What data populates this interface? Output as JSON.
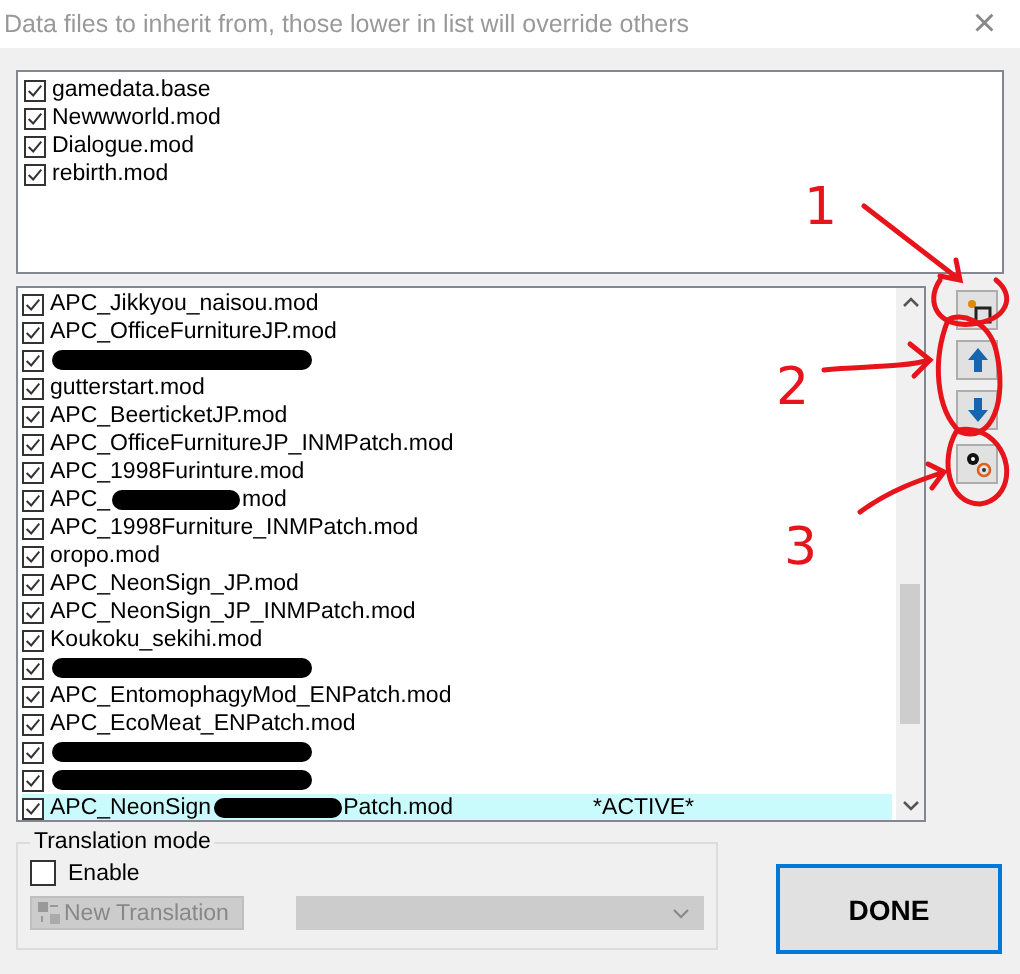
{
  "window": {
    "title": "Data files to inherit from, those lower in list will override others",
    "close": "×"
  },
  "base_files": [
    {
      "label": "gamedata.base",
      "checked": true
    },
    {
      "label": "Newwworld.mod",
      "checked": true
    },
    {
      "label": "Dialogue.mod",
      "checked": true
    },
    {
      "label": "rebirth.mod",
      "checked": true
    }
  ],
  "mod_files": [
    {
      "kind": "plain",
      "before": "APC_Jikkyou_naisou.mod",
      "checked": true,
      "selected": false
    },
    {
      "kind": "plain",
      "before": "APC_OfficeFurnitureJP.mod",
      "checked": true,
      "selected": false
    },
    {
      "kind": "redacted",
      "checked": true,
      "selected": false
    },
    {
      "kind": "plain",
      "before": "gutterstart.mod",
      "checked": true,
      "selected": false
    },
    {
      "kind": "plain",
      "before": "APC_BeerticketJP.mod",
      "checked": true,
      "selected": false
    },
    {
      "kind": "plain",
      "before": "APC_OfficeFurnitureJP_INMPatch.mod",
      "checked": true,
      "selected": false
    },
    {
      "kind": "plain",
      "before": "APC_1998Furinture.mod",
      "checked": true,
      "selected": false
    },
    {
      "kind": "partial",
      "before": "APC_",
      "after": "mod",
      "checked": true,
      "selected": false
    },
    {
      "kind": "plain",
      "before": "APC_1998Furniture_INMPatch.mod",
      "checked": true,
      "selected": false
    },
    {
      "kind": "plain",
      "before": "oropo.mod",
      "checked": true,
      "selected": false
    },
    {
      "kind": "plain",
      "before": "APC_NeonSign_JP.mod",
      "checked": true,
      "selected": false
    },
    {
      "kind": "plain",
      "before": "APC_NeonSign_JP_INMPatch.mod",
      "checked": true,
      "selected": false
    },
    {
      "kind": "plain",
      "before": "Koukoku_sekihi.mod",
      "checked": true,
      "selected": false
    },
    {
      "kind": "redacted",
      "checked": true,
      "selected": false
    },
    {
      "kind": "plain",
      "before": "APC_EntomophagyMod_ENPatch.mod",
      "checked": true,
      "selected": false
    },
    {
      "kind": "plain",
      "before": "APC_EcoMeat_ENPatch.mod",
      "checked": true,
      "selected": false
    },
    {
      "kind": "redacted",
      "checked": true,
      "selected": false
    },
    {
      "kind": "redacted",
      "checked": true,
      "selected": false
    },
    {
      "kind": "partial",
      "before": "APC_NeonSign",
      "after": "Patch.mod",
      "checked": true,
      "selected": true,
      "status": "*ACTIVE*"
    }
  ],
  "translation_mode": {
    "title": "Translation mode",
    "enable": {
      "label": "Enable",
      "checked": false
    },
    "new_button": {
      "label": "New Translation",
      "disabled": true
    },
    "dropdown": {
      "disabled": true
    }
  },
  "done_button": {
    "label": "DONE"
  },
  "annotations": [
    "1",
    "2",
    "3"
  ]
}
